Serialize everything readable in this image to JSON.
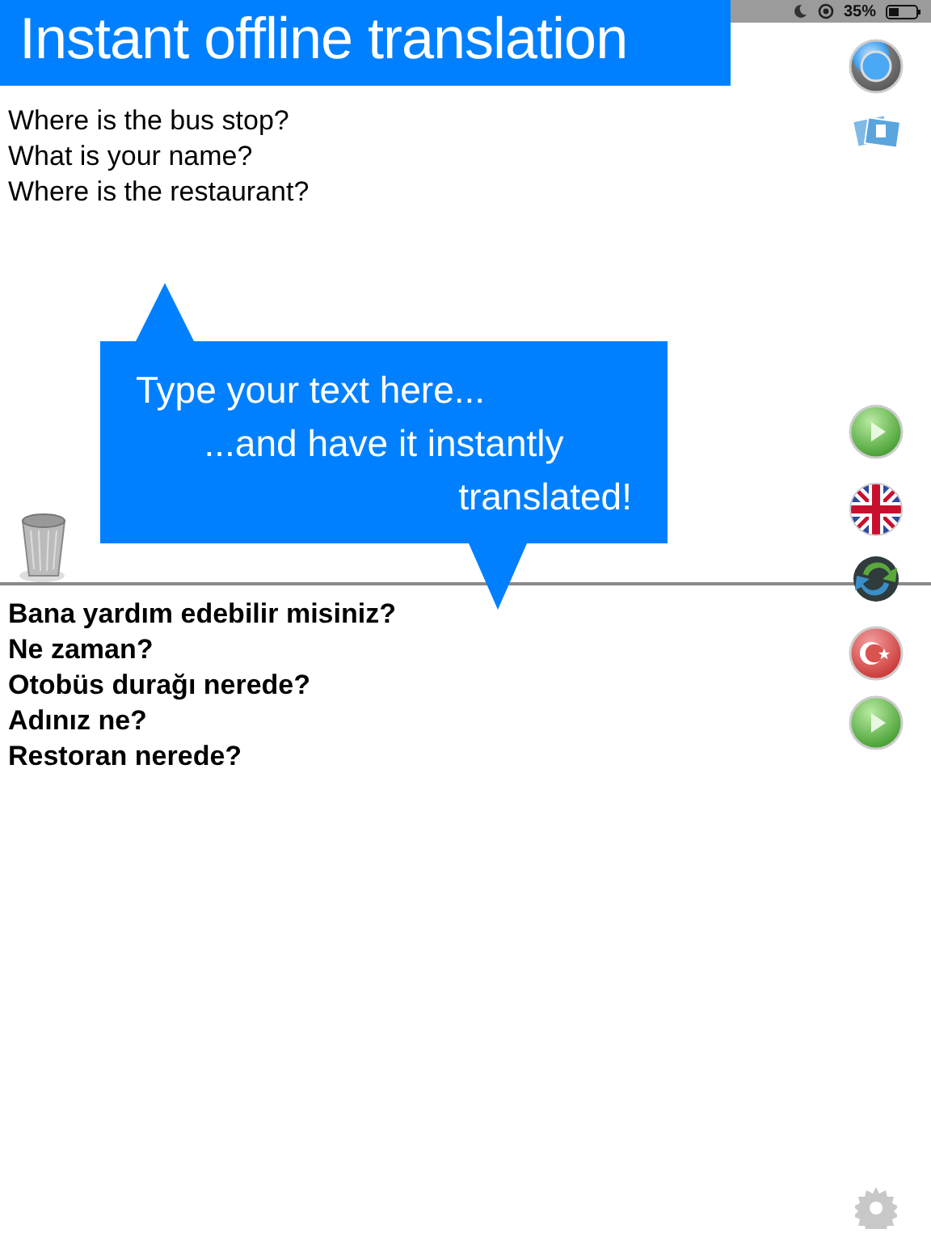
{
  "status_bar": {
    "battery": "35%"
  },
  "banner": {
    "title": "Instant offline translation"
  },
  "source_pane": {
    "lines": [
      "Where is the bus stop?",
      "What is your name?",
      "Where is the restaurant?"
    ]
  },
  "callout": {
    "lines": [
      "Type your text here...",
      "...and have it instantly",
      "translated!"
    ]
  },
  "target_pane": {
    "lines": [
      "Bana yardım edebilir misiniz?",
      "Ne zaman?",
      "Otobüs durağı nerede?",
      "Adınız ne?",
      "Restoran nerede?"
    ]
  }
}
